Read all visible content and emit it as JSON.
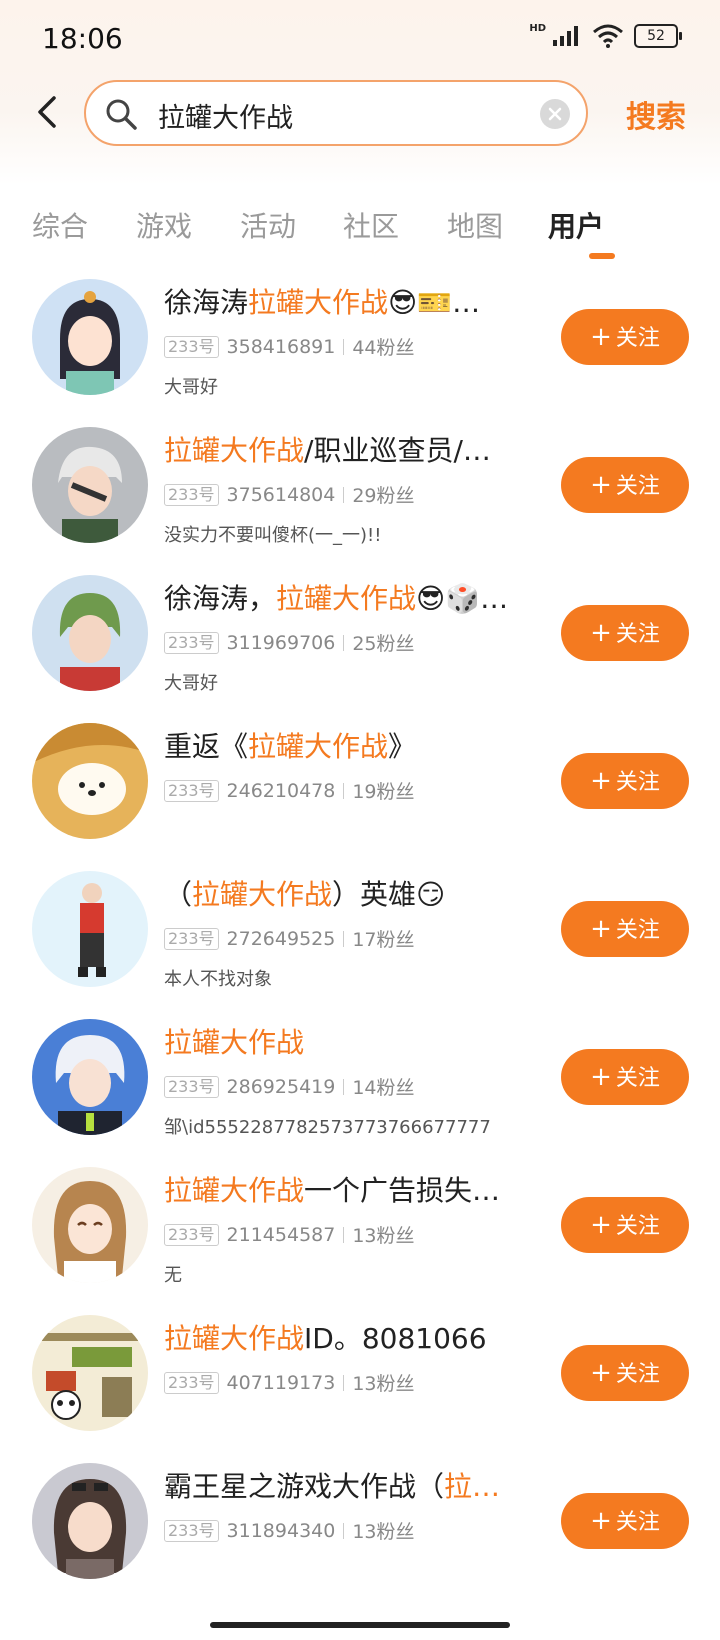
{
  "status_bar": {
    "time": "18:06",
    "signal_label": "HD",
    "battery": "52"
  },
  "search": {
    "query": "拉罐大作战",
    "button": "搜索"
  },
  "tabs": [
    "综合",
    "游戏",
    "活动",
    "社区",
    "地图",
    "用户"
  ],
  "active_tab": "用户",
  "colors": {
    "accent": "#f47a20"
  },
  "users": [
    {
      "name_pre": "徐海涛",
      "name_hl": "拉罐大作战",
      "name_post": "😎🎫…",
      "badge": "233号",
      "id": "358416891",
      "fans": "44粉丝",
      "bio": "大哥好",
      "follow": "关注",
      "avatar": "anime-girl-avatar"
    },
    {
      "name_pre": "",
      "name_hl": "拉罐大作战",
      "name_post": "/职业巡查员/…",
      "badge": "233号",
      "id": "375614804",
      "fans": "29粉丝",
      "bio": "没实力不要叫傻杯(一_一)!!",
      "follow": "关注",
      "avatar": "eyepatch-boy-avatar"
    },
    {
      "name_pre": "徐海涛，",
      "name_hl": "拉罐大作战",
      "name_post": "😎🎲…",
      "badge": "233号",
      "id": "311969706",
      "fans": "25粉丝",
      "bio": "大哥好",
      "follow": "关注",
      "avatar": "green-hair-avatar"
    },
    {
      "name_pre": "重返《",
      "name_hl": "拉罐大作战",
      "name_post": "》",
      "badge": "233号",
      "id": "246210478",
      "fans": "19粉丝",
      "bio": "",
      "follow": "关注",
      "avatar": "cartoon-bear-avatar"
    },
    {
      "name_pre": "（",
      "name_hl": "拉罐大作战",
      "name_post": "）英雄😏",
      "badge": "233号",
      "id": "272649525",
      "fans": "17粉丝",
      "bio": "本人不找对象",
      "follow": "关注",
      "avatar": "standing-character-avatar"
    },
    {
      "name_pre": "",
      "name_hl": "拉罐大作战",
      "name_post": "",
      "badge": "233号",
      "id": "286925419",
      "fans": "14粉丝",
      "bio": "邹\\id5552287782573773766677777",
      "follow": "关注",
      "avatar": "white-hair-avatar"
    },
    {
      "name_pre": "",
      "name_hl": "拉罐大作战",
      "name_post": "一个广告损失…",
      "badge": "233号",
      "id": "211454587",
      "fans": "13粉丝",
      "bio": "无",
      "follow": "关注",
      "avatar": "laughing-girl-avatar"
    },
    {
      "name_pre": "",
      "name_hl": "拉罐大作战",
      "name_post": "ID。8081066",
      "badge": "233号",
      "id": "407119173",
      "fans": "13粉丝",
      "bio": "",
      "follow": "关注",
      "avatar": "panda-sticker-avatar"
    },
    {
      "name_pre": "霸王星之游戏大作战（",
      "name_hl": "拉…",
      "name_post": "",
      "badge": "233号",
      "id": "311894340",
      "fans": "13粉丝",
      "bio": "",
      "follow": "关注",
      "avatar": "sunglasses-girl-avatar"
    }
  ]
}
